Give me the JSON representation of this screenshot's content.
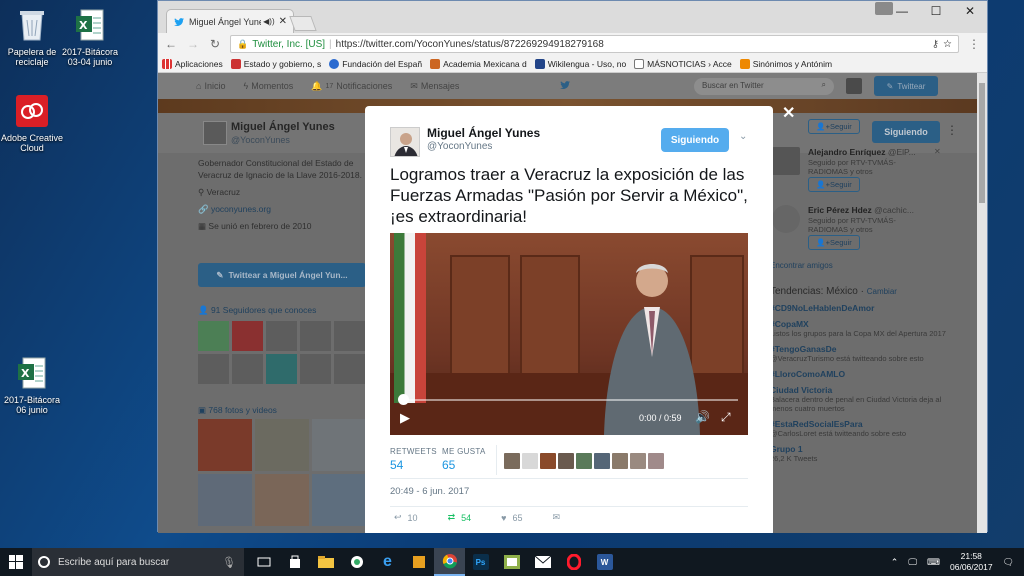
{
  "desktop": {
    "icons": [
      {
        "label": "Papelera de reciclaje",
        "icon": "recycle-bin-icon"
      },
      {
        "label": "2017-Bitácora 03-04 junio",
        "icon": "excel-file-icon"
      },
      {
        "label": "Adobe Creative Cloud",
        "icon": "adobe-cc-icon"
      },
      {
        "label": "2017-Bitácora 06 junio",
        "icon": "excel-file-icon"
      }
    ]
  },
  "browser": {
    "tab_title": "Miguel Ángel Yunes e",
    "address_secure": "Twitter, Inc. [US]",
    "address_url": "https://twitter.com/YoconYunes/status/872269294918279168",
    "bookmarks": [
      "Aplicaciones",
      "Estado y gobierno, s",
      "Fundación del Españ",
      "Academia Mexicana d",
      "Wikilengua - Uso, no",
      "MÁSNOTICIAS › Acce",
      "Sinónimos y Antónim"
    ]
  },
  "twitter": {
    "nav": [
      "Inicio",
      "Momentos",
      "Notificaciones",
      "Mensajes"
    ],
    "notif_count": "17",
    "search_placeholder": "Buscar en Twitter",
    "tweet_button": "Twittear",
    "profile": {
      "name": "Miguel Ángel Yunes",
      "handle": "@YoconYunes",
      "follow_label": "Siguiendo",
      "bio": "Gobernador Constitucional del Estado de Veracruz de Ignacio de la Llave 2016-2018.",
      "location": "Veracruz",
      "website": "yoconyunes.org",
      "joined": "Se unió en febrero de 2010",
      "tweet_to": "Twittear a Miguel Ángel Yun...",
      "followers_known": "91 Seguidores que conoces",
      "photos": "768 fotos y videos"
    },
    "suggestions": [
      {
        "name": "Alejandro Enríquez",
        "handle": "@ElP...",
        "sub": "Seguido por RTV-TVMÁS-RADIOMAS y otros",
        "follow": "Seguir"
      },
      {
        "name": "Eric Pérez Hdez",
        "handle": "@cachic...",
        "sub": "Seguido por RTV-TVMÁS-RADIOMAS y otros",
        "follow": "Seguir"
      }
    ],
    "top_follow": "Seguir",
    "find_friends": "Encontrar amigos",
    "trends_title": "Tendencias: México",
    "trends_change": "Cambiar",
    "trends": [
      {
        "name": "#CD9NoLeHablenDeAmor",
        "desc": ""
      },
      {
        "name": "#CopaMX",
        "desc": "Listos los grupos para la Copa MX del Apertura 2017"
      },
      {
        "name": "#TengoGanasDe",
        "desc": "@VeracruzTurismo está twitteando sobre esto"
      },
      {
        "name": "#LloroComoAMLO",
        "desc": ""
      },
      {
        "name": "Ciudad Victoria",
        "desc": "Balacera dentro de penal en Ciudad Victoria deja al menos cuatro muertos"
      },
      {
        "name": "#EstaRedSocialEsPara",
        "desc": "@CarlosLoret está twitteando sobre esto"
      },
      {
        "name": "Grupo 1",
        "desc": "26,2 K Tweets"
      }
    ]
  },
  "tweet": {
    "name": "Miguel Ángel Yunes",
    "handle": "@YoconYunes",
    "follow_label": "Siguiendo",
    "text": "Logramos traer a Veracruz la exposición de las Fuerzas Armadas \"Pasión por Servir a México\", ¡es extraordinaria!",
    "video_time": "0:00 / 0:59",
    "video_progress": 0,
    "retweets_label": "RETWEETS",
    "retweets": "54",
    "likes_label": "ME GUSTA",
    "likes": "65",
    "date": "20:49 - 6 jun. 2017",
    "reply_count": "10",
    "rt_count": "54",
    "like_count": "65"
  },
  "taskbar": {
    "search_placeholder": "Escribe aquí para buscar",
    "time": "21:58",
    "date": "06/06/2017"
  },
  "colors": {
    "twitter_blue": "#55acee",
    "link_blue": "#1b95e0",
    "retweet_green": "#17bf63"
  }
}
